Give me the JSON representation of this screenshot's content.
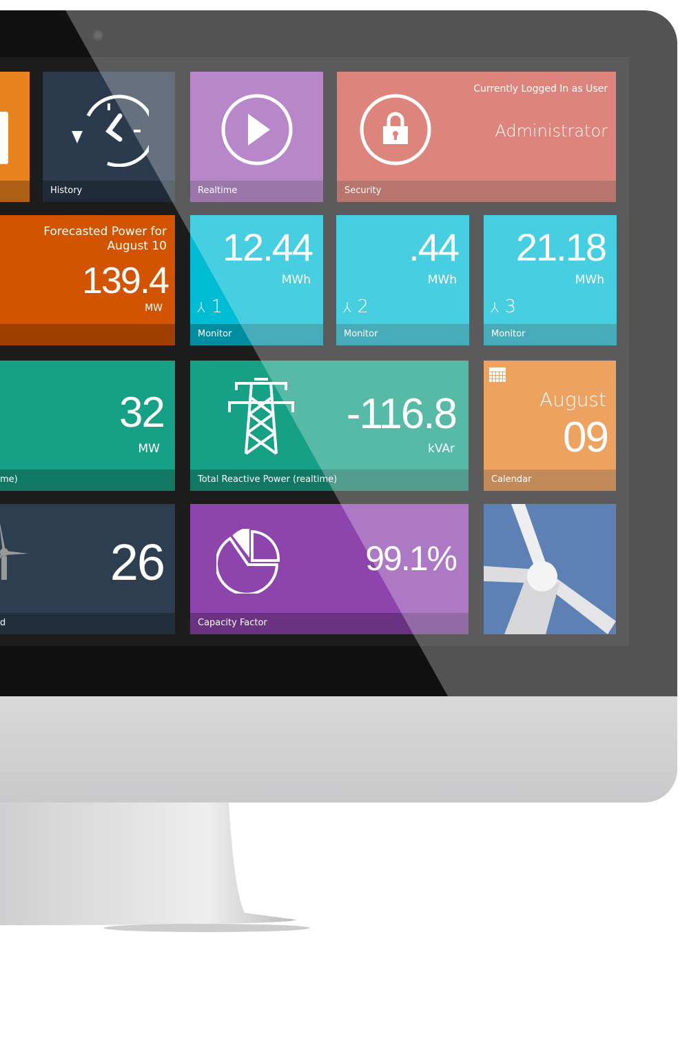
{
  "tiles": {
    "history": {
      "label": "History",
      "icon": "history-clock-icon",
      "color": "#2b3a4d"
    },
    "realtime": {
      "label": "Realtime",
      "icon": "play-circle-icon",
      "color": "#9b59b6"
    },
    "security": {
      "label": "Security",
      "icon": "lock-icon",
      "color": "#d0564a",
      "logged_in_text": "Currently Logged In as User",
      "user": "Administrator"
    },
    "forecast": {
      "title_line1": "Forecasted Power for",
      "title_line2": "August 10",
      "value": "139.4",
      "unit": "MW",
      "color": "#d35400"
    },
    "monitors": [
      {
        "value": "12.44",
        "unit": "MWh",
        "turbine": "1",
        "label": "Monitor"
      },
      {
        "value": ".44",
        "unit": "MWh",
        "turbine": "2",
        "label": "Monitor"
      },
      {
        "value": "21.18",
        "unit": "MWh",
        "turbine": "3",
        "label": "Monitor"
      }
    ],
    "active_power": {
      "value": "32",
      "unit": "MW",
      "label": "me)",
      "color": "#16a085"
    },
    "reactive_power": {
      "value": "-116.8",
      "unit": "kVAr",
      "label": "Total Reactive Power (realtime)",
      "icon": "transmission-tower-icon",
      "color": "#16a085"
    },
    "calendar": {
      "month": "August",
      "day": "09",
      "label": "Calendar",
      "icon": "calendar-icon",
      "color": "#e67e22"
    },
    "turbines": {
      "value": "26",
      "label": "d",
      "icon": "wind-turbine-icon",
      "color": "#2c3e50"
    },
    "capacity": {
      "value": "99.1%",
      "label": "Capacity Factor",
      "icon": "pie-chart-icon",
      "color": "#8e44ad"
    },
    "photo": {
      "icon": "wind-turbine-photo",
      "color": "#1f4f99"
    }
  },
  "monitor_color": "#00bcd4"
}
